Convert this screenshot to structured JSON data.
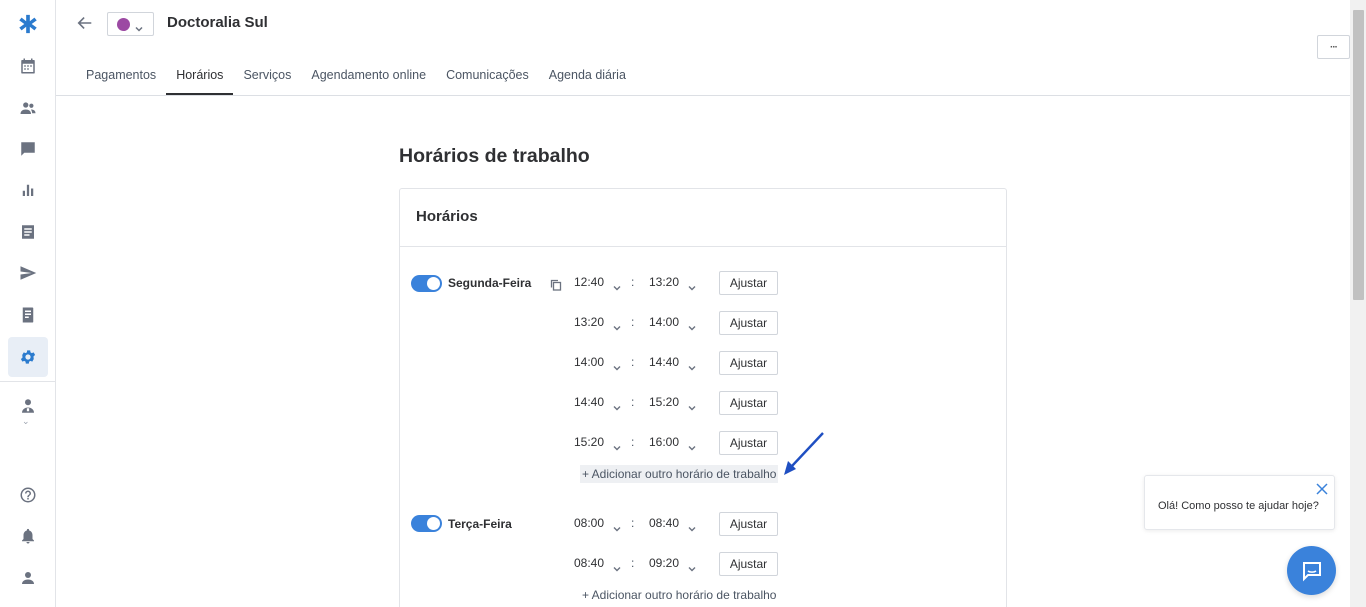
{
  "header": {
    "title": "Doctoralia Sul",
    "color_dot": "#9c4aa3",
    "more_label": "···"
  },
  "tabs": [
    {
      "label": "Pagamentos",
      "active": false
    },
    {
      "label": "Horários",
      "active": true
    },
    {
      "label": "Serviços",
      "active": false
    },
    {
      "label": "Agendamento online",
      "active": false
    },
    {
      "label": "Comunicações",
      "active": false
    },
    {
      "label": "Agenda diária",
      "active": false
    }
  ],
  "sidebar": {
    "icons": [
      "logo-icon",
      "calendar-icon",
      "patients-icon",
      "chat-icon",
      "stats-icon",
      "list-icon",
      "send-icon",
      "book-icon",
      "gear-icon",
      "doctor-icon",
      "help-icon",
      "bell-icon",
      "user-icon"
    ],
    "active": "gear-icon"
  },
  "main": {
    "title": "Horários de trabalho",
    "card_title": "Horários",
    "days": [
      {
        "label": "Segunda-Feira",
        "enabled": true,
        "slots": [
          {
            "start": "12:40",
            "end": "13:20",
            "action": "Ajustar"
          },
          {
            "start": "13:20",
            "end": "14:00",
            "action": "Ajustar"
          },
          {
            "start": "14:00",
            "end": "14:40",
            "action": "Ajustar"
          },
          {
            "start": "14:40",
            "end": "15:20",
            "action": "Ajustar"
          },
          {
            "start": "15:20",
            "end": "16:00",
            "action": "Ajustar"
          }
        ],
        "add_label": "+ Adicionar outro horário de trabalho"
      },
      {
        "label": "Terça-Feira",
        "enabled": true,
        "slots": [
          {
            "start": "08:00",
            "end": "08:40",
            "action": "Ajustar"
          },
          {
            "start": "08:40",
            "end": "09:20",
            "action": "Ajustar"
          }
        ],
        "add_label": "+ Adicionar outro horário de trabalho"
      }
    ],
    "separator": ":"
  },
  "chat": {
    "message": "Olá! Como posso te ajudar hoje?"
  },
  "colors": {
    "accent": "#3a82db",
    "arrow": "#1f4fc2"
  }
}
